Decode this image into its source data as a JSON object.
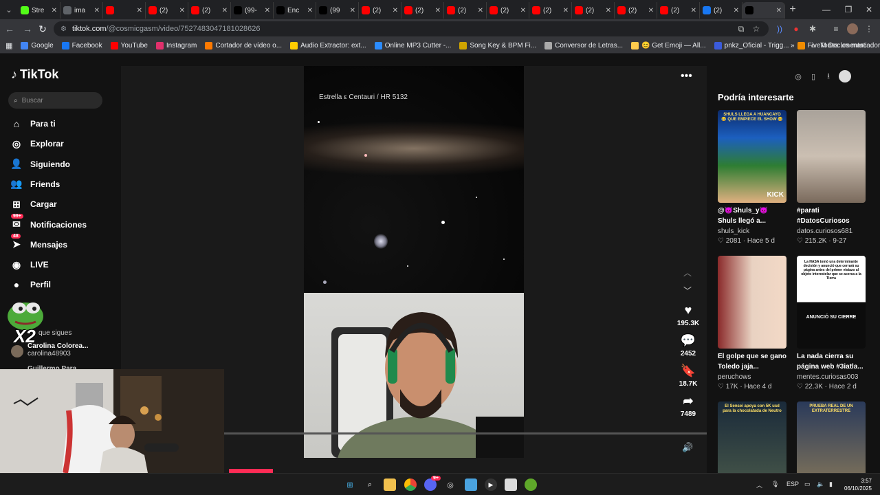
{
  "browser": {
    "tabs": [
      {
        "label": "Stre",
        "icon": "kick-icon",
        "color": "#53fc18"
      },
      {
        "label": "ima",
        "icon": "globe-icon",
        "color": "#5f6368"
      },
      {
        "label": "",
        "icon": "youtube-icon",
        "color": "#ff0000"
      },
      {
        "label": "(2)",
        "icon": "youtube-icon",
        "color": "#ff0000"
      },
      {
        "label": "(2)",
        "icon": "youtube-icon",
        "color": "#ff0000"
      },
      {
        "label": "(99-",
        "icon": "tiktok-icon",
        "color": "#000000"
      },
      {
        "label": "Enc",
        "icon": "tiktok-icon",
        "color": "#000000"
      },
      {
        "label": "(99",
        "icon": "tiktok-icon",
        "color": "#000000"
      },
      {
        "label": "(2)",
        "icon": "youtube-icon",
        "color": "#ff0000"
      },
      {
        "label": "(2)",
        "icon": "youtube-icon",
        "color": "#ff0000"
      },
      {
        "label": "(2)",
        "icon": "youtube-icon",
        "color": "#ff0000"
      },
      {
        "label": "(2)",
        "icon": "youtube-icon",
        "color": "#ff0000"
      },
      {
        "label": "(2)",
        "icon": "youtube-icon",
        "color": "#ff0000"
      },
      {
        "label": "(2)",
        "icon": "youtube-icon",
        "color": "#ff0000"
      },
      {
        "label": "(2)",
        "icon": "youtube-icon",
        "color": "#ff0000"
      },
      {
        "label": "(2)",
        "icon": "youtube-icon",
        "color": "#ff0000"
      },
      {
        "label": "(2)",
        "icon": "facebook-icon",
        "color": "#1877f2"
      },
      {
        "label": "",
        "icon": "tiktok-icon",
        "color": "#000000",
        "active": true
      }
    ],
    "url_host": "tiktok.com",
    "url_path": "/@cosmicgasm/video/7527483047181028626",
    "bookmarks": [
      {
        "label": "Google",
        "icon": "google-icon",
        "color": "#4285f4"
      },
      {
        "label": "Facebook",
        "icon": "facebook-icon",
        "color": "#1877f2"
      },
      {
        "label": "YouTube",
        "icon": "youtube-icon",
        "color": "#ff0000"
      },
      {
        "label": "Instagram",
        "icon": "instagram-icon",
        "color": "#e1306c"
      },
      {
        "label": "Cortador de vídeo o...",
        "icon": "scissors-icon",
        "color": "#ff7a00"
      },
      {
        "label": "Audio Extractor: ext...",
        "icon": "audio-icon",
        "color": "#ffcc00"
      },
      {
        "label": "Online MP3 Cutter -...",
        "icon": "mp3-icon",
        "color": "#2b8cff"
      },
      {
        "label": "Song Key & BPM Fi...",
        "icon": "music-icon",
        "color": "#cfa400"
      },
      {
        "label": "Conversor de Letras...",
        "icon": "text-icon",
        "color": "#aaaaaa"
      },
      {
        "label": "😊 Get Emoji — All...",
        "icon": "emoji-icon",
        "color": "#ffcc4d"
      },
      {
        "label": "pnkz_Oficial - Trigg...",
        "icon": "trigger-icon",
        "color": "#3b5bdb"
      },
      {
        "label": "FiveM Documentati...",
        "icon": "fivem-icon",
        "color": "#f08c00"
      }
    ],
    "bookmarks_folder": "Todos los marcadores"
  },
  "tiktok": {
    "logo": "TikTok",
    "search_placeholder": "Buscar",
    "nav": [
      {
        "label": "Para ti",
        "icon": "home-icon"
      },
      {
        "label": "Explorar",
        "icon": "compass-icon"
      },
      {
        "label": "Siguiendo",
        "icon": "following-icon"
      },
      {
        "label": "Friends",
        "icon": "friends-icon"
      },
      {
        "label": "Cargar",
        "icon": "upload-icon"
      },
      {
        "label": "Notificaciones",
        "icon": "notifications-icon",
        "badge": "99+"
      },
      {
        "label": "Mensajes",
        "icon": "messages-icon",
        "badge": "48"
      },
      {
        "label": "LIVE",
        "icon": "live-icon"
      },
      {
        "label": "Perfil",
        "icon": "profile-icon"
      }
    ],
    "following_title": "que sigues",
    "following_user": {
      "name": "Carolina Colorea...",
      "handle": "carolina48903"
    },
    "following_user_2": "Guillermo Para",
    "video_caption": "Estrella ε Centauri / HR 5132",
    "progress": 0.0,
    "actions": {
      "likes": "195.3K",
      "comments": "2452",
      "saves": "18.7K",
      "shares": "7489"
    },
    "suggested_title": "Podría interesarte",
    "suggested": [
      {
        "caption1": "@👿Shuls_y👿",
        "caption2": "Shuls llegó a...",
        "author": "shuls_kick",
        "likes": "2081",
        "time": "Hace 5 d",
        "thumb_text": "SHULS LLEGA A HUANCAYO 😂 QUE EMPIECE EL SHOW 😂",
        "thumb_label": "KICK"
      },
      {
        "caption1": "#parati",
        "caption2": "#DatosCuriosos",
        "author": "datos.curiosos681",
        "likes": "215.2K",
        "time": "9-27",
        "thumb_text": "",
        "thumb_label": ""
      },
      {
        "caption1": "El golpe que se gano",
        "caption2": "Toledo jaja...",
        "author": "peruchows",
        "likes": "17K",
        "time": "Hace 4 d",
        "thumb_text": "",
        "thumb_label": ""
      },
      {
        "caption1": "La nada cierra su",
        "caption2": "página web #3iatla...",
        "author": "mentes.curiosas003",
        "likes": "22.3K",
        "time": "Hace 2 d",
        "thumb_text": "La NASA tomó una determinante decisión y anunció que cerrará su página antes del primer vistazo al objeto interestelar que se acerca a la Tierra",
        "thumb_label": "ANUNCIÓ SU CIERRE"
      },
      {
        "caption1": "",
        "caption2": "",
        "author": "",
        "likes": "",
        "time": "",
        "thumb_text": "El Sensei apoya con 5K usd para la chocolatada de Neutro",
        "thumb_label": ""
      },
      {
        "caption1": "",
        "caption2": "",
        "author": "",
        "likes": "",
        "time": "",
        "thumb_text": "PRUEBA REAL DE UN EXTRATERRESTRE",
        "thumb_label": ""
      }
    ]
  },
  "overlay": {
    "emote_text": "X2"
  },
  "taskbar": {
    "lang": "ESP",
    "time": "3:57",
    "date": "06/10/2025",
    "chat_badge": "9+"
  }
}
